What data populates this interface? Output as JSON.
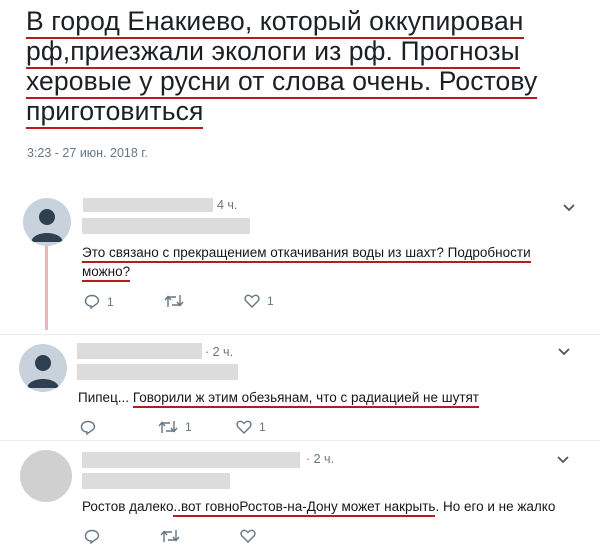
{
  "tweet": {
    "lines": [
      "В город Енакиево, который оккупирован",
      "рф,приезжали экологи из рф. Прогнозы",
      "херовые у русни от слова очень. Ростову",
      "приготовиться"
    ],
    "timestamp": "3:23 - 27 июн. 2018 г."
  },
  "replies": [
    {
      "time": "4 ч.",
      "text_line1": "Это связано с прекращением откачивания воды из шахт? Подробности",
      "text_line2": "можно?",
      "reply_count": "1",
      "retweet_count": "",
      "like_count": "1"
    },
    {
      "time": "· 2 ч.",
      "text_prefix": "Пипец... ",
      "text_underlined": "Говорили ж этим обезьянам, что с радиацией не шутят",
      "reply_count": "",
      "retweet_count": "1",
      "like_count": "1"
    },
    {
      "time": "· 2 ч.",
      "text_prefix": "Ростов далеко",
      "text_underlined": "..вот говноРостов-на-Дону может накрыть",
      "text_suffix": ". Но его и не жалко",
      "reply_count": "",
      "retweet_count": "",
      "like_count": ""
    }
  ],
  "colors": {
    "underline": "#b71c1c",
    "secondary_text": "#657786",
    "redaction": "#dcdcdc"
  },
  "icons": [
    "reply-icon",
    "retweet-icon",
    "like-icon",
    "chevron-down-icon",
    "default-avatar-icon"
  ]
}
